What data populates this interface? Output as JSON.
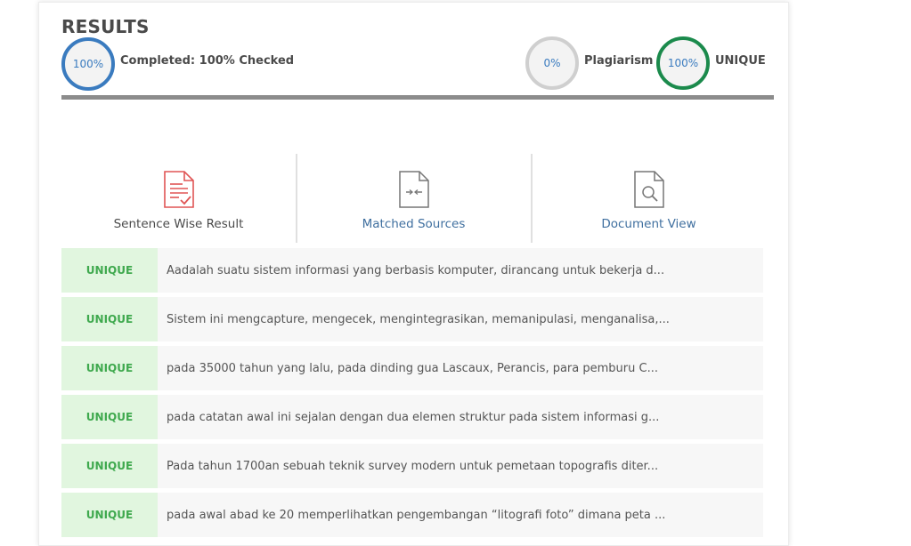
{
  "header": {
    "title": "RESULTS",
    "completed_ring": "100%",
    "completed_label": "Completed: 100% Checked",
    "plagiarism_ring": "0%",
    "plagiarism_label": "Plagiarism",
    "unique_ring": "100%",
    "unique_label": "UNIQUE",
    "progress_percent": 100
  },
  "tabs": [
    {
      "label": "Sentence Wise Result",
      "icon": "document-check-icon"
    },
    {
      "label": "Matched Sources",
      "icon": "document-compare-icon"
    },
    {
      "label": "Document View",
      "icon": "document-search-icon"
    }
  ],
  "rows": [
    {
      "status": "UNIQUE",
      "text": "Aadalah suatu sistem informasi yang berbasis komputer, dirancang untuk bekerja d..."
    },
    {
      "status": "UNIQUE",
      "text": "Sistem ini mengcapture, mengecek, mengintegrasikan, memanipulasi, menganalisa,..."
    },
    {
      "status": "UNIQUE",
      "text": "pada 35000 tahun yang lalu, pada dinding gua Lascaux, Perancis, para pemburu C..."
    },
    {
      "status": "UNIQUE",
      "text": "pada catatan awal ini sejalan dengan dua elemen struktur pada sistem informasi g..."
    },
    {
      "status": "UNIQUE",
      "text": "Pada tahun 1700an sebuah teknik survey modern untuk pemetaan topografis diter..."
    },
    {
      "status": "UNIQUE",
      "text": "pada awal abad ke 20 memperlihatkan pengembangan “litografi foto” dimana peta ..."
    }
  ],
  "colors": {
    "accent_blue": "#3a7bbf",
    "unique_green": "#1b8a4c",
    "badge_bg": "#e1f6df",
    "badge_text": "#3fa94e",
    "icon_red": "#e05555"
  }
}
